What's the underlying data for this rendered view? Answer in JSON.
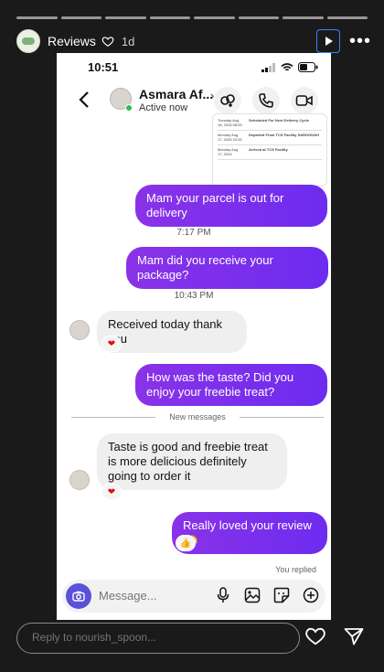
{
  "story": {
    "account_name": "Reviews",
    "age": "1d",
    "reply_placeholder": "Reply to nourish_spoon..."
  },
  "phone": {
    "time": "10:51"
  },
  "chat": {
    "peer_name": "Asmara Af...",
    "peer_status": "Active now",
    "receipt_rows": [
      {
        "date": "Tuesday Aug 18, 2026 08:00",
        "event": "Scheduled For Next Delivery Cycle"
      },
      {
        "date": "Monday Aug 17, 2026 22:00",
        "event": "Departed From TCS Facility SARGODAH"
      },
      {
        "date": "Monday Aug 17, 2026",
        "event": "Arrived at TCS Facility"
      }
    ],
    "messages": [
      {
        "text": "Mam your parcel is out for delivery"
      },
      {
        "time": "7:17 PM"
      },
      {
        "text": "Mam did you receive your package?"
      },
      {
        "time": "10:43 PM"
      },
      {
        "text": "Received today thank you",
        "reaction": "❤"
      },
      {
        "text": "How was the taste? Did you enjoy your freebie treat?"
      },
      {
        "divider": "New messages"
      },
      {
        "text": "Taste is good and freebie treat is more delicious definitely going to order it",
        "reaction": "❤"
      },
      {
        "text": "Really loved your review🫶",
        "reaction": "👍"
      }
    ],
    "you_replied": "You replied",
    "composer_placeholder": "Message..."
  },
  "icons": {
    "heart": "heart-icon",
    "play": "play-icon",
    "more": "more-icon",
    "back": "back-arrow-icon",
    "add_people": "add-people-icon",
    "call": "phone-icon",
    "video": "video-icon",
    "camera": "camera-icon",
    "mic": "mic-icon",
    "gallery": "gallery-icon",
    "sticker": "sticker-icon",
    "plus": "plus-icon",
    "send": "send-icon"
  },
  "colors": {
    "outgoing_bubble": "#7b2ff2",
    "incoming_bubble": "#efefef",
    "camera_button": "#5b51d8",
    "online": "#2fbb4f"
  }
}
